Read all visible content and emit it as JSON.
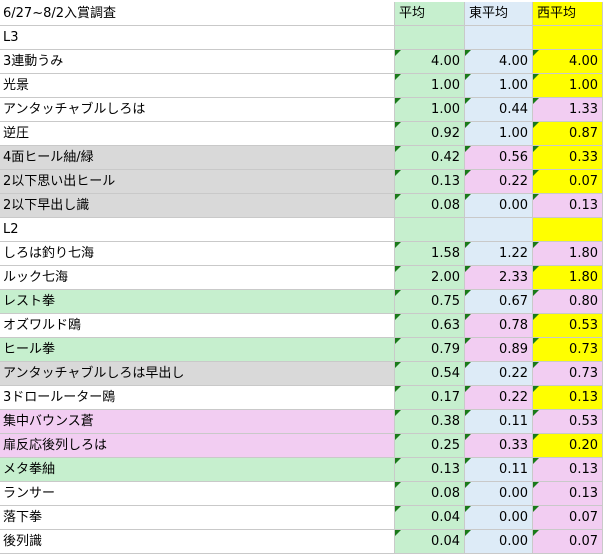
{
  "header": {
    "title": "6/27~8/2入賞調査",
    "col1": "平均",
    "col2": "東平均",
    "col3": "西平均"
  },
  "colors": {
    "green": "#c6efce",
    "blue": "#ddebf7",
    "pink": "#f2cdf2",
    "yellow": "#ffff00",
    "gray": "#d9d9d9",
    "white": "#ffffff"
  },
  "rows": [
    {
      "name": "L3",
      "avg": "",
      "east": "",
      "west": "",
      "bg": [
        "white",
        "green",
        "blue",
        "yellow"
      ]
    },
    {
      "name": "3連動うみ",
      "avg": "4.00",
      "east": "4.00",
      "west": "4.00",
      "bg": [
        "white",
        "green",
        "blue",
        "yellow"
      ]
    },
    {
      "name": "光景",
      "avg": "1.00",
      "east": "1.00",
      "west": "1.00",
      "bg": [
        "white",
        "green",
        "blue",
        "yellow"
      ]
    },
    {
      "name": "アンタッチャブルしろは",
      "avg": "1.00",
      "east": "0.44",
      "west": "1.33",
      "bg": [
        "white",
        "green",
        "blue",
        "pink"
      ]
    },
    {
      "name": "逆圧",
      "avg": "0.92",
      "east": "1.00",
      "west": "0.87",
      "bg": [
        "white",
        "green",
        "blue",
        "yellow"
      ]
    },
    {
      "name": "4面ヒール紬/緑",
      "avg": "0.42",
      "east": "0.56",
      "west": "0.33",
      "bg": [
        "gray",
        "green",
        "pink",
        "yellow"
      ]
    },
    {
      "name": "2以下思い出ヒール",
      "avg": "0.13",
      "east": "0.22",
      "west": "0.07",
      "bg": [
        "gray",
        "green",
        "pink",
        "yellow"
      ]
    },
    {
      "name": "2以下早出し識",
      "avg": "0.08",
      "east": "0.00",
      "west": "0.13",
      "bg": [
        "gray",
        "green",
        "blue",
        "pink"
      ]
    },
    {
      "name": "L2",
      "avg": "",
      "east": "",
      "west": "",
      "bg": [
        "white",
        "green",
        "blue",
        "yellow"
      ]
    },
    {
      "name": "しろは釣り七海",
      "avg": "1.58",
      "east": "1.22",
      "west": "1.80",
      "bg": [
        "white",
        "green",
        "blue",
        "pink"
      ]
    },
    {
      "name": "ルック七海",
      "avg": "2.00",
      "east": "2.33",
      "west": "1.80",
      "bg": [
        "white",
        "green",
        "pink",
        "yellow"
      ]
    },
    {
      "name": "レスト拳",
      "avg": "0.75",
      "east": "0.67",
      "west": "0.80",
      "bg": [
        "green",
        "green",
        "blue",
        "pink"
      ]
    },
    {
      "name": "オズワルド鴎",
      "avg": "0.63",
      "east": "0.78",
      "west": "0.53",
      "bg": [
        "white",
        "green",
        "pink",
        "yellow"
      ]
    },
    {
      "name": "ヒール拳",
      "avg": "0.79",
      "east": "0.89",
      "west": "0.73",
      "bg": [
        "green",
        "green",
        "pink",
        "yellow"
      ]
    },
    {
      "name": "アンタッチャブルしろは早出し",
      "avg": "0.54",
      "east": "0.22",
      "west": "0.73",
      "bg": [
        "gray",
        "green",
        "blue",
        "pink"
      ]
    },
    {
      "name": "3ドロールーター鴎",
      "avg": "0.17",
      "east": "0.22",
      "west": "0.13",
      "bg": [
        "white",
        "green",
        "pink",
        "yellow"
      ]
    },
    {
      "name": "集中バウンス蒼",
      "avg": "0.38",
      "east": "0.11",
      "west": "0.53",
      "bg": [
        "pink",
        "green",
        "blue",
        "pink"
      ]
    },
    {
      "name": "扉反応後列しろは",
      "avg": "0.25",
      "east": "0.33",
      "west": "0.20",
      "bg": [
        "pink",
        "green",
        "pink",
        "yellow"
      ]
    },
    {
      "name": "メタ拳紬",
      "avg": "0.13",
      "east": "0.11",
      "west": "0.13",
      "bg": [
        "green",
        "green",
        "blue",
        "pink"
      ]
    },
    {
      "name": "ランサー",
      "avg": "0.08",
      "east": "0.00",
      "west": "0.13",
      "bg": [
        "white",
        "green",
        "blue",
        "pink"
      ]
    },
    {
      "name": "落下拳",
      "avg": "0.04",
      "east": "0.00",
      "west": "0.07",
      "bg": [
        "white",
        "green",
        "blue",
        "pink"
      ]
    },
    {
      "name": "後列識",
      "avg": "0.04",
      "east": "0.00",
      "west": "0.07",
      "bg": [
        "white",
        "green",
        "blue",
        "pink"
      ]
    }
  ]
}
